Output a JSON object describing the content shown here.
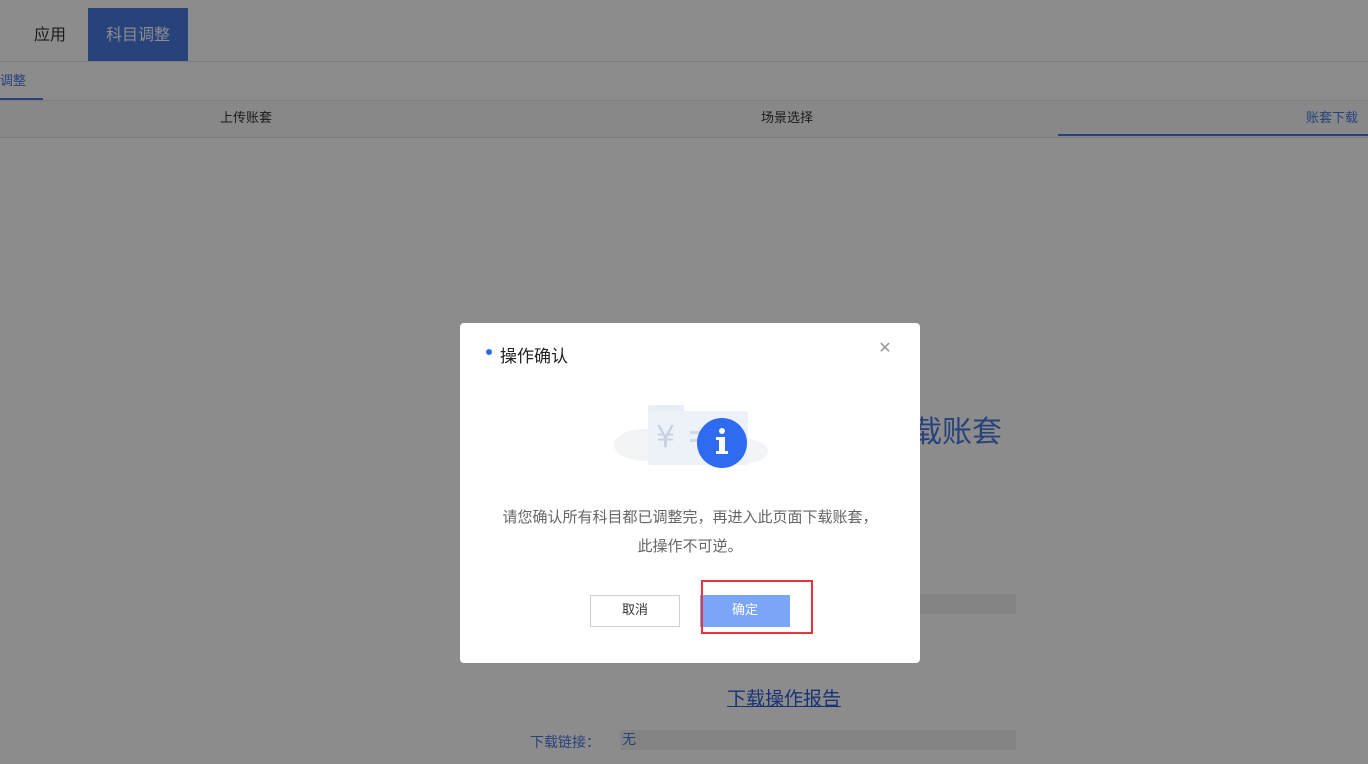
{
  "header": {
    "tabs": [
      {
        "label": "应用"
      },
      {
        "label": "科目调整"
      }
    ]
  },
  "subnav": {
    "active_label": "调整"
  },
  "steps": [
    {
      "label": "上传账套"
    },
    {
      "label": "场景选择"
    },
    {
      "label": "账套下载"
    }
  ],
  "page": {
    "title_fragment": "载账套",
    "report_link": "下载操作报告",
    "link_label": "下载链接：",
    "link_value": "无"
  },
  "modal": {
    "title": "操作确认",
    "close_icon": "close-icon",
    "message_line1": "请您确认所有科目都已调整完，再进入此页面下载账套，",
    "message_line2": "此操作不可逆。",
    "cancel_label": "取消",
    "ok_label": "确定",
    "info_icon": "info-icon",
    "currency_symbol": "¥"
  },
  "colors": {
    "accent": "#4a78e0",
    "ok_button": "#7ba5f7",
    "highlight_border": "#e8343a"
  }
}
